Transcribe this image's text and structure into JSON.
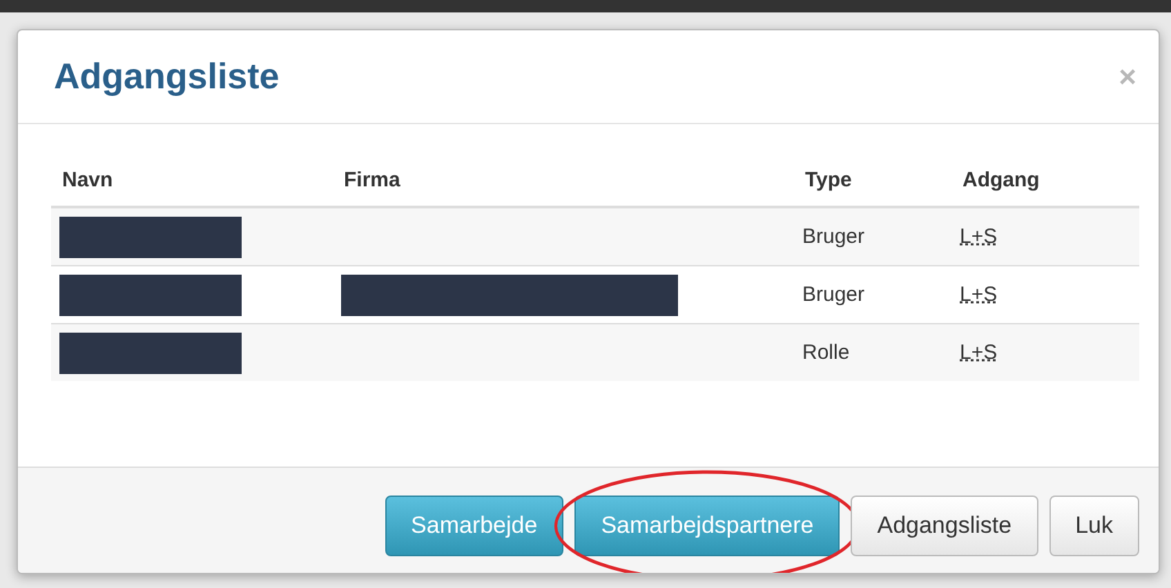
{
  "dialog": {
    "title": "Adgangsliste",
    "close": "×"
  },
  "table": {
    "columns": [
      "Navn",
      "Firma",
      "Type",
      "Adgang"
    ],
    "rows": [
      {
        "name_redacted": true,
        "company_redacted": false,
        "type": "Bruger",
        "access": "L+S"
      },
      {
        "name_redacted": true,
        "company_redacted": true,
        "type": "Bruger",
        "access": "L+S"
      },
      {
        "name_redacted": true,
        "company_redacted": false,
        "type": "Rolle",
        "access": "L+S"
      }
    ]
  },
  "buttons": [
    {
      "label": "Samarbejde",
      "kind": "primary",
      "circled": false
    },
    {
      "label": "Samarbejdspartnere",
      "kind": "primary",
      "circled": true
    },
    {
      "label": "Adgangsliste",
      "kind": "default",
      "circled": false
    },
    {
      "label": "Luk",
      "kind": "default",
      "circled": false
    }
  ]
}
